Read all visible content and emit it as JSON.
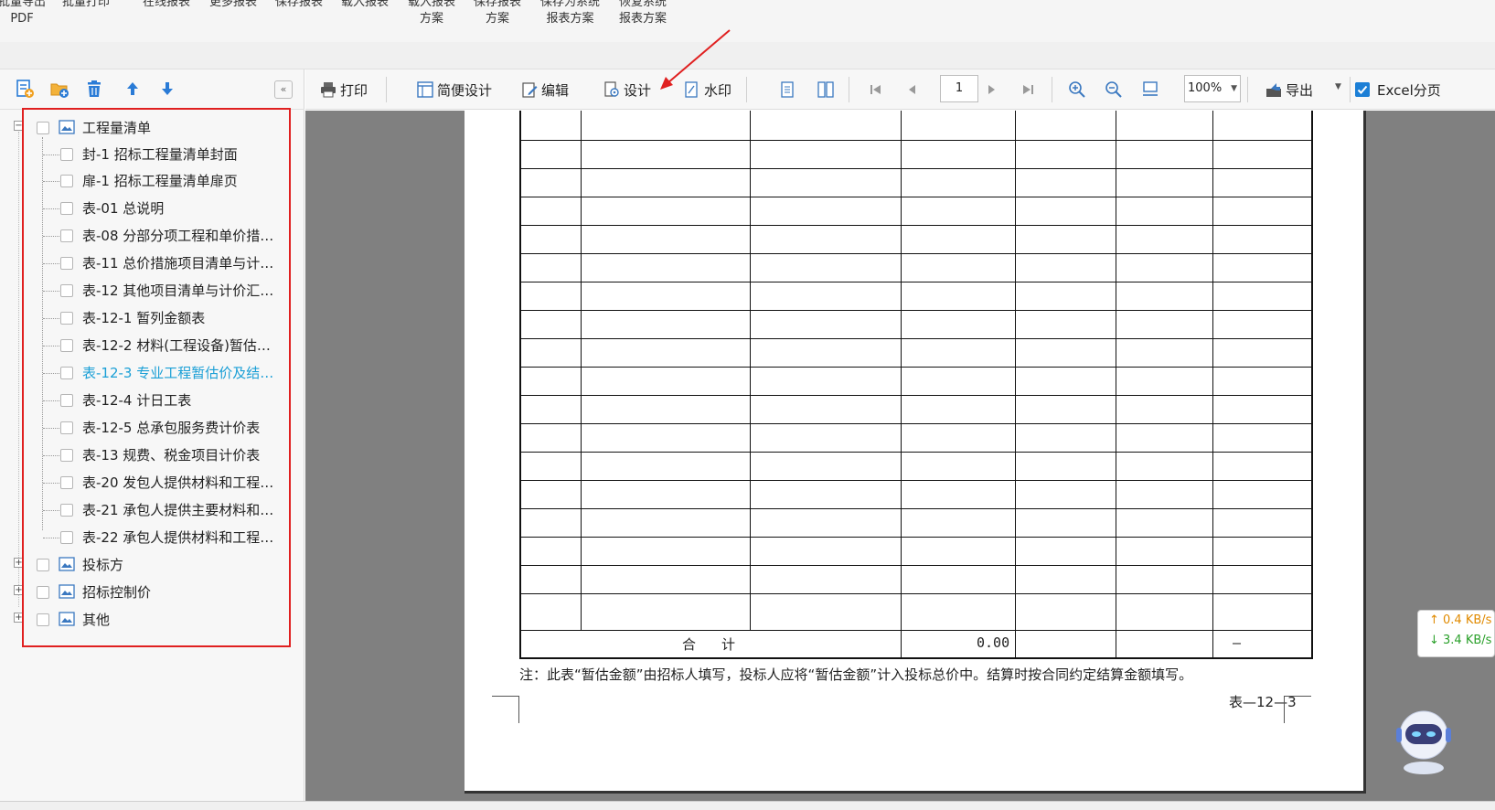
{
  "ribbon": {
    "items": [
      {
        "line1": "批量导出",
        "line2": "PDF"
      },
      {
        "line1": "批量打印",
        "line2": ""
      },
      {
        "line1": "在线报表",
        "line2": ""
      },
      {
        "line1": "更多报表",
        "line2": ""
      },
      {
        "line1": "保存报表",
        "line2": ""
      },
      {
        "line1": "载入报表",
        "line2": ""
      },
      {
        "line1": "载入报表",
        "line2": "方案"
      },
      {
        "line1": "保存报表",
        "line2": "方案"
      },
      {
        "line1": "保存为系统",
        "line2": "报表方案"
      },
      {
        "line1": "恢复系统",
        "line2": "报表方案"
      }
    ]
  },
  "left_toolbar": {
    "collapse_label": "«"
  },
  "tree": {
    "root": {
      "label": "工程量清单"
    },
    "children": [
      {
        "label": "封-1 招标工程量清单封面"
      },
      {
        "label": "扉-1 招标工程量清单扉页"
      },
      {
        "label": "表-01 总说明"
      },
      {
        "label": "表-08 分部分项工程和单价措…"
      },
      {
        "label": "表-11 总价措施项目清单与计…"
      },
      {
        "label": "表-12 其他项目清单与计价汇…"
      },
      {
        "label": "表-12-1 暂列金额表"
      },
      {
        "label": "表-12-2 材料(工程设备)暂估…"
      },
      {
        "label": "表-12-3 专业工程暂估价及结…"
      },
      {
        "label": "表-12-4 计日工表"
      },
      {
        "label": "表-12-5 总承包服务费计价表"
      },
      {
        "label": "表-13 规费、税金项目计价表"
      },
      {
        "label": "表-20 发包人提供材料和工程…"
      },
      {
        "label": "表-21 承包人提供主要材料和…"
      },
      {
        "label": "表-22 承包人提供材料和工程…"
      }
    ],
    "others": [
      {
        "label": "投标方"
      },
      {
        "label": "招标控制价"
      },
      {
        "label": "其他"
      }
    ]
  },
  "toolbar": {
    "print": "打印",
    "simple_design": "简便设计",
    "edit": "编辑",
    "design": "设计",
    "watermark": "水印",
    "page": "1",
    "zoom": "100%",
    "export": "导出",
    "excel_paging": "Excel分页"
  },
  "report": {
    "total_label": "合计",
    "total_value": "0.00",
    "total_dash": "—",
    "note": "注：此表“暂估金额”由招标人填写，投标人应将“暂估金额”计入投标总价中。结算时按合同约定结算金额填写。",
    "table_code": "表—12—3"
  },
  "network": {
    "up": "↑ 0.4 KB/s",
    "down": "↓ 3.4 KB/s"
  }
}
